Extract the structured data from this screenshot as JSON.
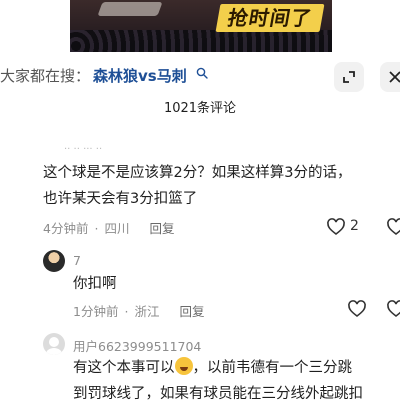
{
  "video": {
    "overlay_text": "抢时间了"
  },
  "search": {
    "prefix": "大家都在搜：",
    "term": "森林狼vs马刺"
  },
  "header": {
    "comment_count": "1021条评论"
  },
  "comments": [
    {
      "faded_user": "·· ·· ··· ··",
      "text_line1": "这个球是不是应该算2分？如果这样算3分的话，",
      "text_line2": "也许某天会有3分扣篮了",
      "time": "4分钟前",
      "location": "四川",
      "reply_label": "回复",
      "likes": "2"
    },
    {
      "username": "7",
      "text": "你扣啊",
      "time": "1分钟前",
      "location": "浙江",
      "reply_label": "回复",
      "likes": ""
    },
    {
      "username": "用户6623999511704",
      "text_line1_before": "有这个本事可以",
      "text_line1_after": "，以前韦德有一个三分跳",
      "text_line2": "到罚球线了，如果有球员能在三分线外起跳扣"
    }
  ],
  "icons": {
    "search": "search-icon",
    "expand": "expand-icon",
    "close": "close-icon",
    "like": "heart-icon"
  }
}
